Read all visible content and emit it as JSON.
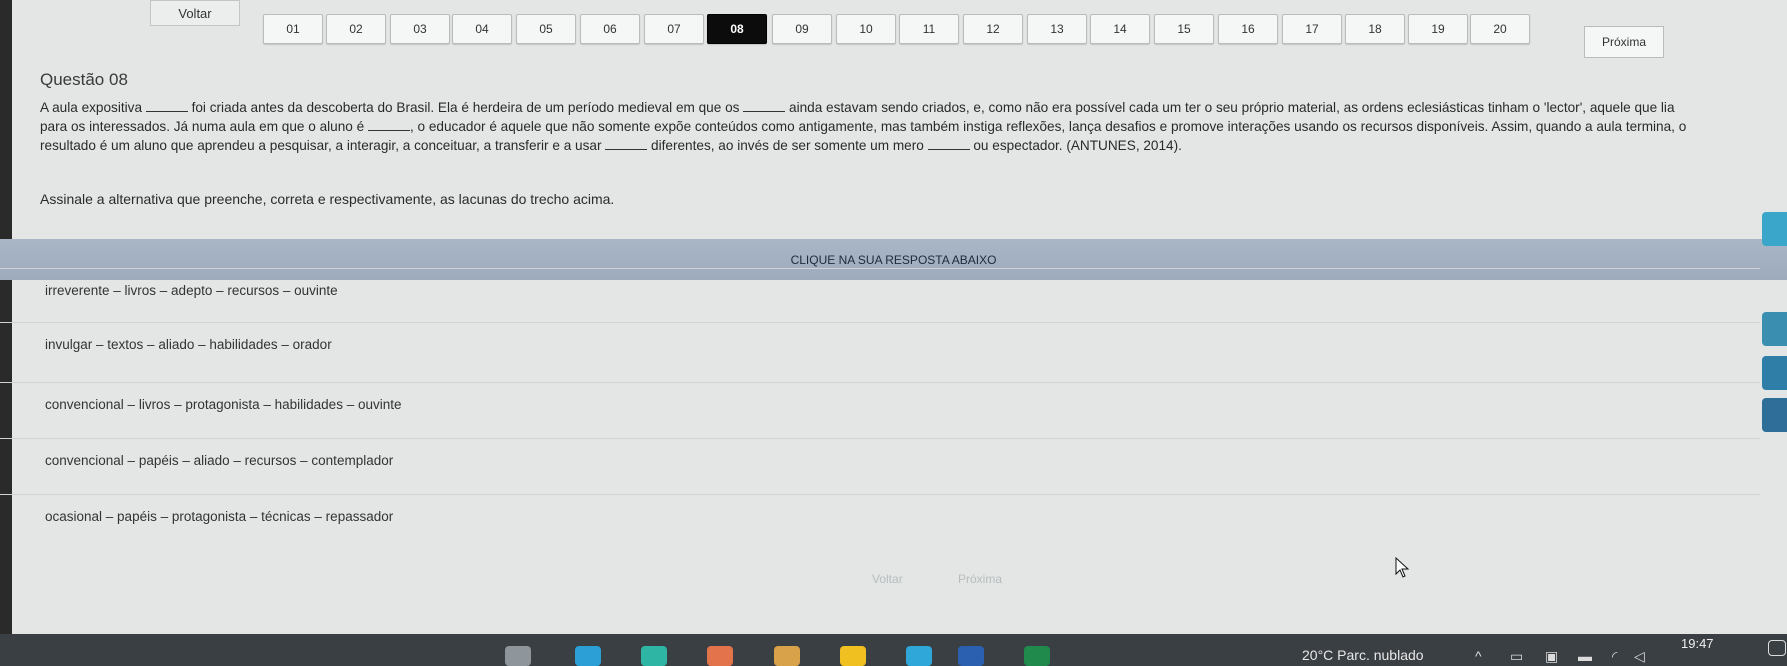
{
  "nav": {
    "back_label": "Voltar",
    "next_label": "Próxima",
    "questions": [
      "01",
      "02",
      "03",
      "04",
      "05",
      "06",
      "07",
      "08",
      "09",
      "10",
      "11",
      "12",
      "13",
      "14",
      "15",
      "16",
      "17",
      "18",
      "19",
      "20"
    ],
    "active_question": "08"
  },
  "question": {
    "title": "Questão 08",
    "line1_a": "A aula expositiva",
    "line1_b": "foi criada antes da descoberta do Brasil. Ela é herdeira de um período medieval em que os",
    "line1_c": "ainda estavam sendo criados, e, como não era possível cada um ter o seu próprio material, as ordens eclesiásticas tinham o 'lector', aquele que lia",
    "line2_a": "para os interessados. Já numa aula em que o aluno é",
    "line2_b": ", o educador é aquele que não somente expõe conteúdos como antigamente, mas também instiga reflexões, lança desafios e promove interações usando os recursos disponíveis. Assim, quando a aula termina, o",
    "line3_a": "resultado é um aluno que aprendeu a pesquisar, a interagir, a conceituar, a transferir e a usar",
    "line3_b": "diferentes, ao invés de ser somente um mero",
    "line3_c": "ou espectador. (ANTUNES, 2014).",
    "instruction": "Assinale a alternativa que preenche, correta e respectivamente, as lacunas do trecho acima."
  },
  "answers": {
    "header": "CLIQUE NA SUA RESPOSTA ABAIXO",
    "options": [
      "irreverente – livros – adepto – recursos – ouvinte",
      "invulgar – textos – aliado – habilidades – orador",
      "convencional – livros – protagonista – habilidades – ouvinte",
      "convencional – papéis – aliado – recursos – contemplador",
      "ocasional – papéis – protagonista – técnicas – repassador"
    ]
  },
  "bottom": {
    "back_label": "Voltar",
    "next_label": "Próxima"
  },
  "taskbar": {
    "weather": "20°C  Parc. nublado",
    "time": "19:47"
  },
  "colors": {
    "active_nav": "#0c0c0c",
    "answer_header": "#a4b1c2",
    "page_background": "#e4e6e6",
    "taskbar": "#3a3f44"
  }
}
